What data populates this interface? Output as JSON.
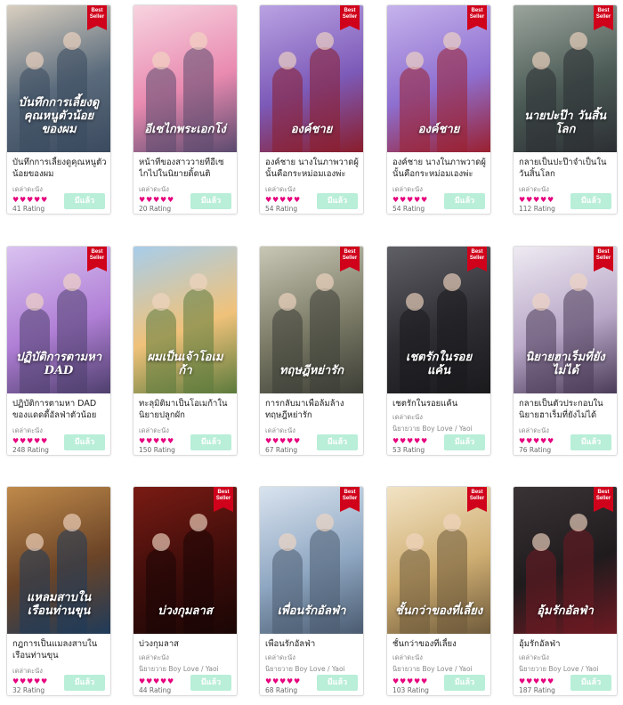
{
  "books": [
    {
      "cover_text": "บันทึกการเลี้ยงดูคุณหนูตัวน้อยของผม",
      "title": "บันทึกการเลี้ยงดูคุณหนูตัวน้อยของผม",
      "author": "เดล่าดะนัง",
      "category": "",
      "rating": "41 Rating",
      "hearts": 5,
      "best_seller": true,
      "button": "มีแล้ว",
      "palette": [
        "#d9cfc0",
        "#5a6b7c",
        "#3b4a5e"
      ]
    },
    {
      "cover_text": "อีเซไกพระเอกโง่",
      "title": "หน้าที่ของสาววายที่อีเซไกไปในนิยายดิ้ดนติ",
      "author": "เดล่าดะนัง",
      "category": "",
      "rating": "20 Rating",
      "hearts": 5,
      "best_seller": false,
      "button": "มีแล้ว",
      "palette": [
        "#f7d3df",
        "#e98ab0",
        "#5b4a6e"
      ]
    },
    {
      "cover_text": "องค์ชาย",
      "title": "องค์ชาย นางในภาพวาดผู้นั้นคือกระหม่อมเองพ่ะ",
      "author": "เดล่าดะนัง",
      "category": "",
      "rating": "54 Rating",
      "hearts": 5,
      "best_seller": true,
      "button": "มีแล้ว",
      "palette": [
        "#b9a2e3",
        "#7c5ab8",
        "#8a1d2b"
      ]
    },
    {
      "cover_text": "องค์ชาย",
      "title": "องค์ชาย นางในภาพวาดผู้นั้นคือกระหม่อมเองพ่ะ",
      "author": "เดล่าดะนัง",
      "category": "",
      "rating": "54 Rating",
      "hearts": 5,
      "best_seller": true,
      "button": "มีแล้ว",
      "palette": [
        "#c6b3ec",
        "#8e6fd0",
        "#9a2030"
      ]
    },
    {
      "cover_text": "นายปะป๊า วันสิ้นโลก",
      "title": "กลายเป็นปะป๊าจำเป็นในวันสิ้นโลก",
      "author": "เดล่าดะนัง",
      "category": "",
      "rating": "112 Rating",
      "hearts": 5,
      "best_seller": true,
      "button": "มีแล้ว",
      "palette": [
        "#9aa49c",
        "#4b5a55",
        "#2c2f33"
      ]
    },
    {
      "cover_text": "ปฏิบัติการตามหา DAD",
      "title": "ปฏิบัติการตามหา DAD ของแดดดี้อัลฟ่าตัวน้อย",
      "author": "เดล่าดะนัง",
      "category": "",
      "rating": "248 Rating",
      "hearts": 5,
      "best_seller": true,
      "button": "มีแล้ว",
      "palette": [
        "#d9c2f0",
        "#b07fd6",
        "#4f3f6d"
      ]
    },
    {
      "cover_text": "ผมเป็นเจ้าโอเมก้า",
      "title": "ทะลุมิติมาเป็นโอเมก้าในนิยายปลูกผัก",
      "author": "เดล่าดะนัง",
      "category": "",
      "rating": "150 Rating",
      "hearts": 5,
      "best_seller": false,
      "button": "มีแล้ว",
      "palette": [
        "#a7cdea",
        "#f0c27a",
        "#5b7a3c"
      ]
    },
    {
      "cover_text": "ทฤษฎีหย่ารัก",
      "title": "การกลับมาเพื่อล้มล้างทฤษฎีหย่ารัก",
      "author": "เดล่าดะนัง",
      "category": "",
      "rating": "67 Rating",
      "hearts": 5,
      "best_seller": true,
      "button": "มีแล้ว",
      "palette": [
        "#c8c6b4",
        "#7a7a66",
        "#3d3e36"
      ]
    },
    {
      "cover_text": "เชตรักในรอยแค้น",
      "title": "เชตรักในรอยแค้น",
      "author": "เดล่าดะนัง",
      "category": "นิยายวาย Boy Love / Yaoi",
      "rating": "53 Rating",
      "hearts": 5,
      "best_seller": true,
      "button": "มีแล้ว",
      "palette": [
        "#5f5f66",
        "#2e2e33",
        "#1a1a1d"
      ]
    },
    {
      "cover_text": "นิยายฮาเร็มที่ยังไม่ได้",
      "title": "กลายเป็นตัวประกอบในนิยายฮาเร็มที่ยังไม่ได้",
      "author": "เดล่าดะนัง",
      "category": "",
      "rating": "76 Rating",
      "hearts": 5,
      "best_seller": true,
      "button": "มีแล้ว",
      "palette": [
        "#eeeaf2",
        "#b9a8c8",
        "#4a3b58"
      ]
    },
    {
      "cover_text": "แหลมสาบในเรือนท่านขุน",
      "title": "กฎการเป็นแมลงสาบในเรือนท่านขุน",
      "author": "เดล่าดะนัง",
      "category": "",
      "rating": "32 Rating",
      "hearts": 5,
      "best_seller": false,
      "button": "มีแล้ว",
      "palette": [
        "#c08a4a",
        "#6b4427",
        "#1f3b5a"
      ]
    },
    {
      "cover_text": "บ่วงกุมลาส",
      "title": "บ่วงกุมลาส",
      "author": "เดล่าดะนัง",
      "category": "นิยายวาย Boy Love / Yaoi",
      "rating": "44 Rating",
      "hearts": 5,
      "best_seller": true,
      "button": "มีแล้ว",
      "palette": [
        "#7a1b14",
        "#3e0d0a",
        "#1a0605"
      ]
    },
    {
      "cover_text": "เพื่อนรักอัลฟ่า",
      "title": "เพื่อนรักอัลฟ่า",
      "author": "เดล่าดะนัง",
      "category": "นิยายวาย Boy Love / Yaoi",
      "rating": "68 Rating",
      "hearts": 5,
      "best_seller": true,
      "button": "มีแล้ว",
      "palette": [
        "#d9e3ef",
        "#8fa7c2",
        "#4a5b70"
      ]
    },
    {
      "cover_text": "ชั้นกว่าของที่เลี้ยง",
      "title": "ชั้นกว่าของที่เลี้ยง",
      "author": "เดล่าดะนัง",
      "category": "นิยายวาย Boy Love / Yaoi",
      "rating": "103 Rating",
      "hearts": 5,
      "best_seller": true,
      "button": "มีแล้ว",
      "palette": [
        "#f2e3c4",
        "#cfae72",
        "#6e5a3b"
      ]
    },
    {
      "cover_text": "อุ้มรักอัลฟ่า",
      "title": "อุ้มรักอัลฟ่า",
      "author": "เดล่าดะนัง",
      "category": "นิยายวาย Boy Love / Yaoi",
      "rating": "187 Rating",
      "hearts": 5,
      "best_seller": true,
      "button": "มีแล้ว",
      "palette": [
        "#3a3336",
        "#1f1b1d",
        "#6e1a22"
      ]
    }
  ],
  "badge_text": "Best Seller",
  "colors": {
    "heart": "#e6007e",
    "badge": "#d0021b",
    "button": "#b9eed8"
  },
  "icons": {
    "heart": "heart-icon"
  }
}
